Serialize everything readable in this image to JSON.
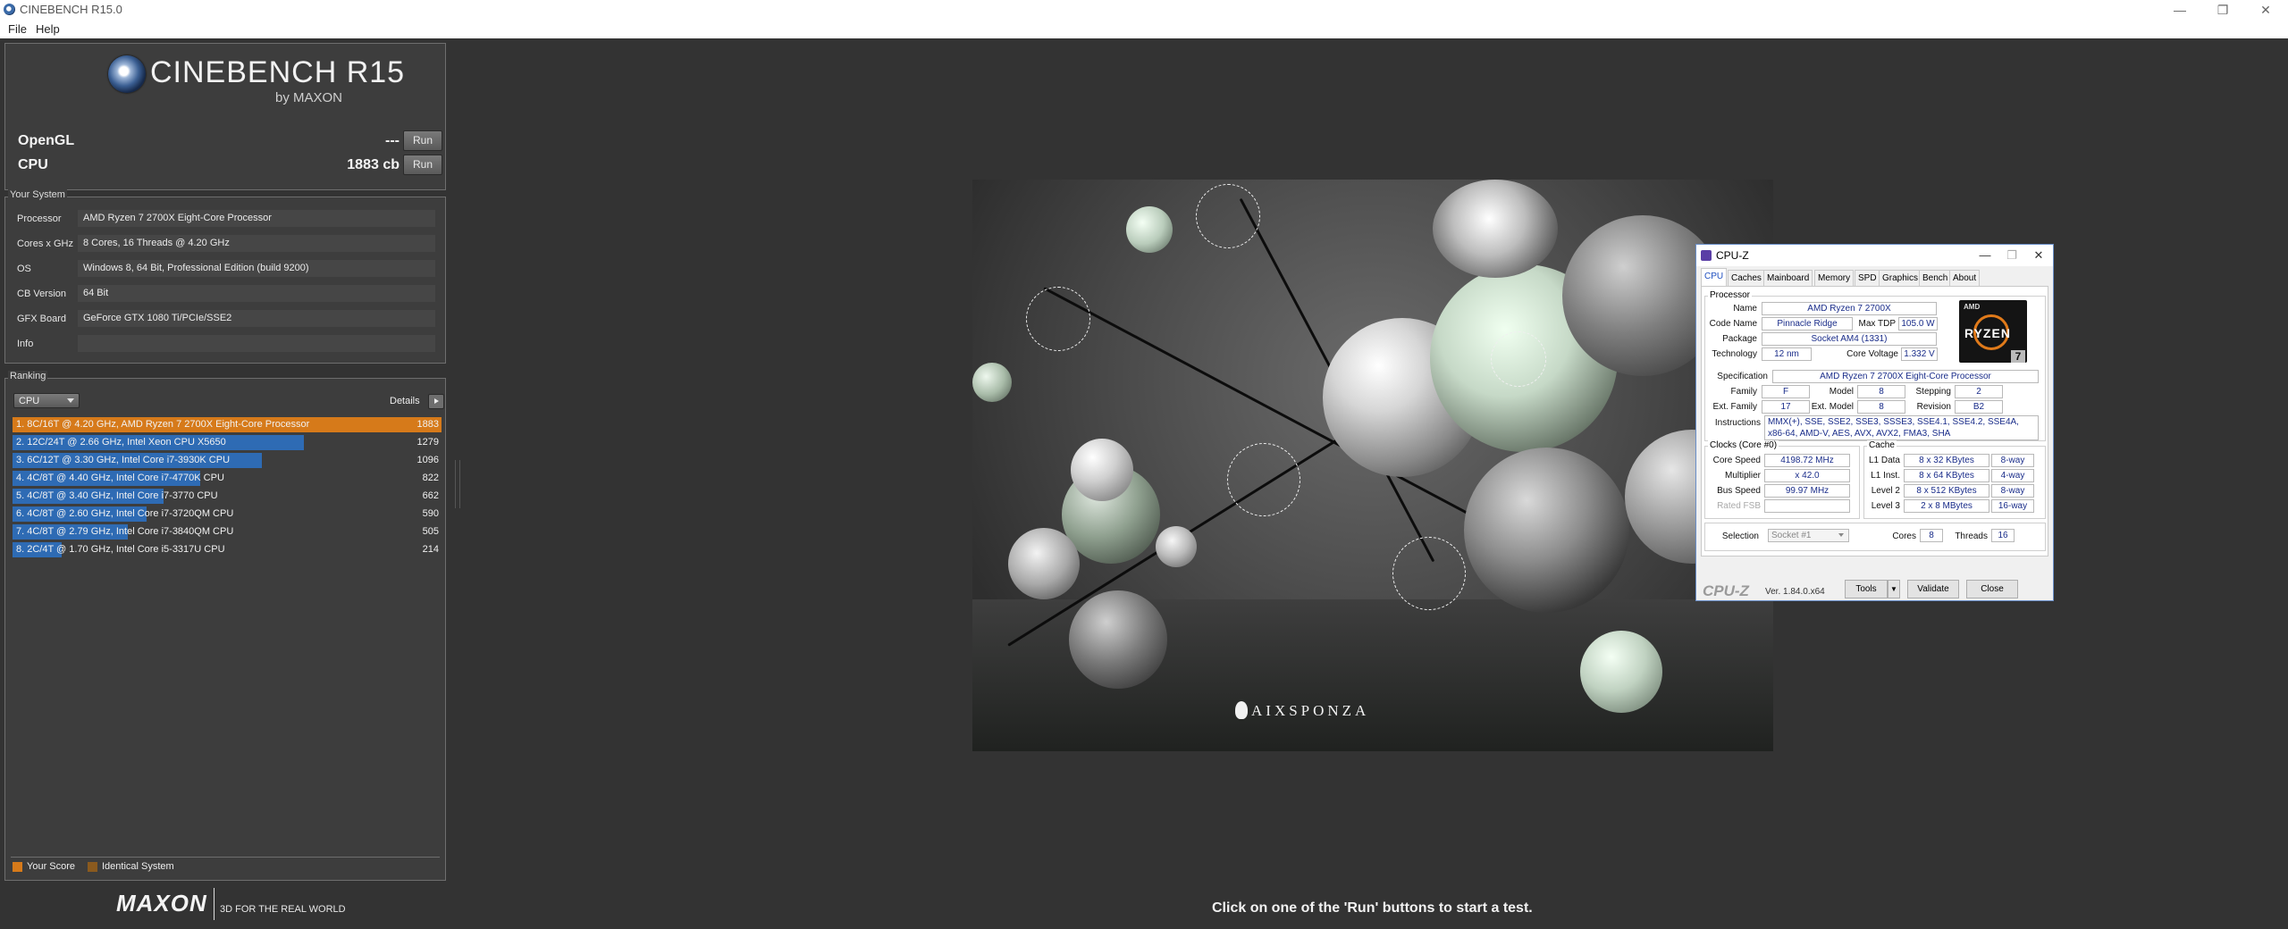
{
  "window": {
    "title": "CINEBENCH R15.0",
    "minimize": "—",
    "maximize": "❐",
    "close": "✕"
  },
  "menu": {
    "file": "File",
    "help": "Help"
  },
  "logo": {
    "name": "CINEBENCH R15",
    "byline": "by MAXON"
  },
  "benchmarks": {
    "opengl": {
      "label": "OpenGL",
      "score": "---",
      "run_label": "Run"
    },
    "cpu": {
      "label": "CPU",
      "score": "1883 cb",
      "run_label": "Run"
    }
  },
  "system": {
    "title": "Your System",
    "rows": [
      {
        "label": "Processor",
        "value": "AMD Ryzen 7 2700X Eight-Core Processor"
      },
      {
        "label": "Cores x GHz",
        "value": "8 Cores, 16 Threads @ 4.20 GHz"
      },
      {
        "label": "OS",
        "value": "Windows 8, 64 Bit, Professional Edition (build 9200)"
      },
      {
        "label": "CB Version",
        "value": "64 Bit"
      },
      {
        "label": "GFX Board",
        "value": "GeForce GTX 1080 Ti/PCIe/SSE2"
      },
      {
        "label": "Info",
        "value": ""
      }
    ]
  },
  "ranking": {
    "title": "Ranking",
    "selected": "CPU",
    "details_label": "Details",
    "max_score": 1883,
    "rows": [
      {
        "text": "1. 8C/16T @ 4.20 GHz, AMD Ryzen 7 2700X Eight-Core Processor",
        "score": "1883",
        "value": 1883,
        "mine": true
      },
      {
        "text": "2. 12C/24T @ 2.66 GHz, Intel Xeon CPU X5650",
        "score": "1279",
        "value": 1279,
        "mine": false
      },
      {
        "text": "3. 6C/12T @ 3.30 GHz,  Intel Core i7-3930K CPU",
        "score": "1096",
        "value": 1096,
        "mine": false
      },
      {
        "text": "4. 4C/8T @ 4.40 GHz, Intel Core i7-4770K CPU",
        "score": "822",
        "value": 822,
        "mine": false
      },
      {
        "text": "5. 4C/8T @ 3.40 GHz,  Intel Core i7-3770 CPU",
        "score": "662",
        "value": 662,
        "mine": false
      },
      {
        "text": "6. 4C/8T @ 2.60 GHz, Intel Core i7-3720QM CPU",
        "score": "590",
        "value": 590,
        "mine": false
      },
      {
        "text": "7. 4C/8T @ 2.79 GHz, Intel Core i7-3840QM CPU",
        "score": "505",
        "value": 505,
        "mine": false
      },
      {
        "text": "8. 2C/4T @ 1.70 GHz,  Intel Core i5-3317U CPU",
        "score": "214",
        "value": 214,
        "mine": false
      }
    ],
    "legend": {
      "your_score": "Your Score",
      "identical": "Identical System"
    }
  },
  "colors": {
    "your_score": "#d67a1a",
    "identical_system": "#8a5a1e",
    "ranking_bar": "#2e6bb4"
  },
  "footer": {
    "brand": "MAXON",
    "slogan": "3D FOR THE REAL WORLD",
    "status": "Click on one of the 'Run' buttons to start a test."
  },
  "render": {
    "watermark": "AIXSPONZA"
  },
  "cpuz": {
    "title": "CPU-Z",
    "tabs": [
      "CPU",
      "Caches",
      "Mainboard",
      "Memory",
      "SPD",
      "Graphics",
      "Bench",
      "About"
    ],
    "active_tab": "CPU",
    "processor": {
      "group": "Processor",
      "name_label": "Name",
      "name": "AMD Ryzen 7 2700X",
      "code_label": "Code Name",
      "code": "Pinnacle Ridge",
      "tdp_label": "Max TDP",
      "tdp": "105.0 W",
      "package_label": "Package",
      "package": "Socket AM4 (1331)",
      "tech_label": "Technology",
      "tech": "12 nm",
      "voltage_label": "Core Voltage",
      "voltage": "1.332 V",
      "spec_label": "Specification",
      "spec": "AMD Ryzen 7 2700X Eight-Core Processor",
      "family_label": "Family",
      "family": "F",
      "model_label": "Model",
      "model": "8",
      "stepping_label": "Stepping",
      "stepping": "2",
      "extfam_label": "Ext. Family",
      "extfam": "17",
      "extmodel_label": "Ext. Model",
      "extmodel": "8",
      "revision_label": "Revision",
      "revision": "B2",
      "instr_label": "Instructions",
      "instr": "MMX(+), SSE, SSE2, SSE3, SSSE3, SSE4.1, SSE4.2, SSE4A, x86-64, AMD-V, AES, AVX, AVX2, FMA3, SHA",
      "badge_brand": "AMD",
      "badge_name": "RYZEN",
      "badge_num": "7"
    },
    "clocks": {
      "group": "Clocks (Core #0)",
      "speed_label": "Core Speed",
      "speed": "4198.72 MHz",
      "mult_label": "Multiplier",
      "mult": "x 42.0",
      "bus_label": "Bus Speed",
      "bus": "99.97 MHz",
      "fsb_label": "Rated FSB",
      "fsb": ""
    },
    "cache": {
      "group": "Cache",
      "l1d_label": "L1 Data",
      "l1d": "8 x 32 KBytes",
      "l1d_way": "8-way",
      "l1i_label": "L1 Inst.",
      "l1i": "8 x 64 KBytes",
      "l1i_way": "4-way",
      "l2_label": "Level 2",
      "l2": "8 x 512 KBytes",
      "l2_way": "8-way",
      "l3_label": "Level 3",
      "l3": "2 x 8 MBytes",
      "l3_way": "16-way"
    },
    "selection": {
      "label": "Selection",
      "value": "Socket #1",
      "cores_label": "Cores",
      "cores": "8",
      "threads_label": "Threads",
      "threads": "16"
    },
    "footer": {
      "logo": "CPU-Z",
      "version": "Ver. 1.84.0.x64",
      "tools": "Tools",
      "validate": "Validate",
      "close": "Close"
    }
  }
}
